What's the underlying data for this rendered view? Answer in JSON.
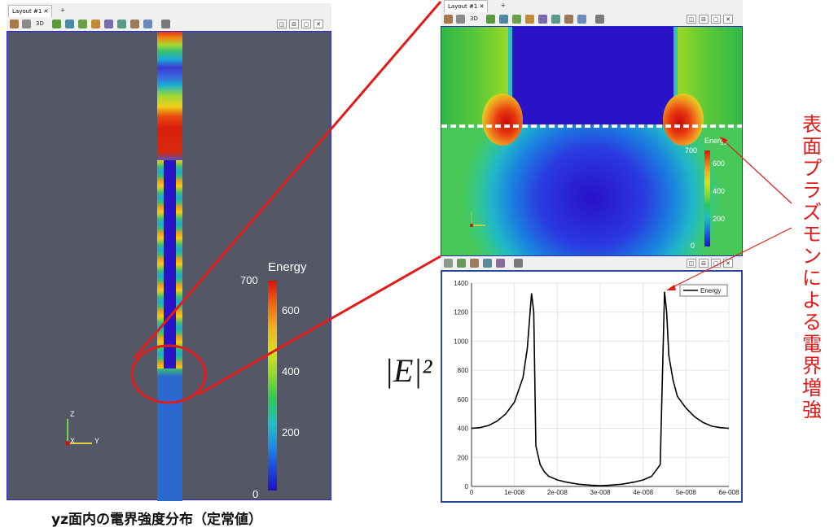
{
  "left_window": {
    "tab_label": "Layout #1 ✕",
    "tab_add": "+",
    "toolbar_3d": "3D",
    "window_buttons": [
      "◫",
      "⊟",
      "▢",
      "✕"
    ],
    "colorbar": {
      "title": "Energy",
      "ticks": [
        "700",
        "600",
        "400",
        "200",
        "0"
      ]
    },
    "axes_triad": {
      "z": "Z",
      "x": "X",
      "y": "Y"
    }
  },
  "right_top_window": {
    "tab_label": "Layout #1 ✕",
    "tab_add": "+",
    "toolbar_3d": "3D",
    "window_buttons": [
      "◫",
      "⊟",
      "▢",
      "✕"
    ],
    "colorbar": {
      "title": "Energy",
      "ticks": [
        "700",
        "600",
        "400",
        "200",
        "0"
      ]
    }
  },
  "right_bottom_window": {
    "window_buttons": [
      "◫",
      "⊟",
      "▢",
      "✕"
    ]
  },
  "y_axis_formula": "|E|²",
  "annotation_text": "表面プラズモンによる電界増強",
  "caption": "yz面内の電界強度分布（定常値）",
  "colors": {
    "highlight_red": "#e11a1a",
    "view_border": "#2a2ad0",
    "background_gray": "#545866"
  },
  "chart_data": {
    "type": "line",
    "series": [
      {
        "name": "Energy",
        "x": [
          0,
          2e-09,
          4e-09,
          6e-09,
          8e-09,
          1e-08,
          1.2e-08,
          1.3e-08,
          1.4e-08,
          1.45e-08,
          1.5e-08,
          1.6e-08,
          1.7e-08,
          1.8e-08,
          2e-08,
          2.2e-08,
          2.5e-08,
          2.8e-08,
          3e-08,
          3.2e-08,
          3.5e-08,
          3.8e-08,
          4e-08,
          4.2e-08,
          4.4e-08,
          4.5e-08,
          4.55e-08,
          4.6e-08,
          4.7e-08,
          4.8e-08,
          5e-08,
          5.2e-08,
          5.4e-08,
          5.6e-08,
          5.8e-08,
          6e-08
        ],
        "y": [
          400,
          405,
          420,
          450,
          500,
          580,
          750,
          950,
          1330,
          1200,
          280,
          150,
          100,
          70,
          45,
          30,
          15,
          8,
          5,
          8,
          15,
          30,
          45,
          70,
          150,
          1340,
          1200,
          900,
          730,
          620,
          540,
          480,
          440,
          415,
          405,
          400
        ]
      }
    ],
    "x_tick_labels": [
      "0",
      "1e-008",
      "2e-008",
      "3e-008",
      "4e-008",
      "5e-008",
      "6e-008"
    ],
    "y_tick_labels": [
      "0",
      "200",
      "400",
      "600",
      "800",
      "1000",
      "1200",
      "1400"
    ],
    "xlim": [
      0,
      6e-08
    ],
    "ylim": [
      0,
      1400
    ],
    "grid": true,
    "legend_placement": "top-right"
  }
}
